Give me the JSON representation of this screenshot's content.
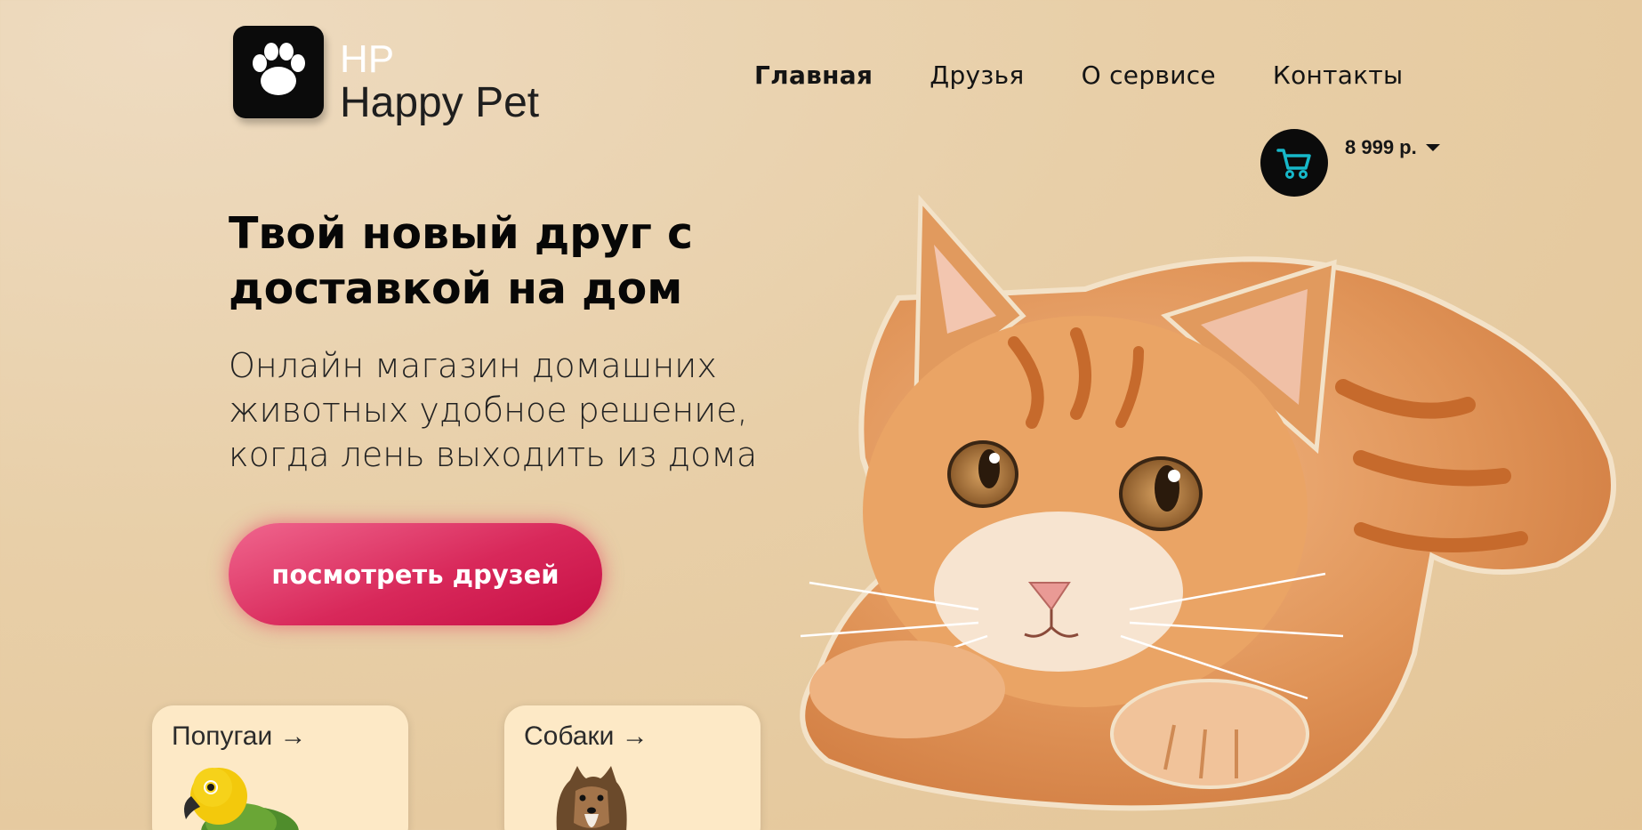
{
  "brand": {
    "short": "HP",
    "name": "Happy Pet"
  },
  "nav": {
    "items": [
      {
        "label": "Главная",
        "active": true
      },
      {
        "label": "Друзья",
        "active": false
      },
      {
        "label": "О сервисе",
        "active": false
      },
      {
        "label": "Контакты",
        "active": false
      }
    ]
  },
  "cart": {
    "icon": "cart-icon",
    "price": "8 999 р."
  },
  "hero": {
    "title_line1": "Твой новый друг с",
    "title_line2": "доставкой на дом",
    "subtitle_line1": "Онлайн магазин домашних",
    "subtitle_line2": "животных удобное решение,",
    "subtitle_line3": "когда лень выходить из дома",
    "cta_label": "посмотреть друзей"
  },
  "categories": [
    {
      "label": "Попугаи →",
      "icon": "parrot-image"
    },
    {
      "label": "Собаки →",
      "icon": "dog-image"
    }
  ],
  "colors": {
    "accent": "#d8285a",
    "cart_icon": "#17b8c9",
    "background": "#e8cfa8",
    "card": "#fde9c6"
  }
}
